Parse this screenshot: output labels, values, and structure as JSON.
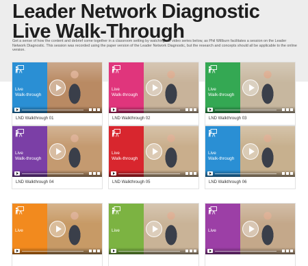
{
  "header": {
    "title_line1": "Leader Network Diagnostic",
    "title_line2": "Live Walk-Through",
    "intro": "Get a sense of how the content and debrief come together in a classroom setting by watching the video series below, as Phil Willburn facilitates a session on the Leader Network Diagnostic. This session was recorded using the paper version of the Leader Network Diagnostic, but the research and concepts should all be applicable to the online version."
  },
  "videos": [
    {
      "title": "LND Walkthrough 01",
      "live_line1": "Live",
      "live_line2": "Walk-through",
      "panel_color": "#2a8fd4",
      "photo_color": "#b98a63"
    },
    {
      "title": "LND Walkthrough 02",
      "live_line1": "Live",
      "live_line2": "Walk-through",
      "panel_color": "#e0357c",
      "photo_color": "#c8b39a"
    },
    {
      "title": "LND Walkthrough 03",
      "live_line1": "Live",
      "live_line2": "Walk-through",
      "panel_color": "#34a853",
      "photo_color": "#c7b79f"
    },
    {
      "title": "LND Walkthrough 04",
      "live_line1": "Live",
      "live_line2": "Walk-through",
      "panel_color": "#7b3fa6",
      "photo_color": "#c49a70"
    },
    {
      "title": "LND Walkthrough 05",
      "live_line1": "Live",
      "live_line2": "Walk-through",
      "panel_color": "#d8262e",
      "photo_color": "#c9ae8c"
    },
    {
      "title": "LND Walkthrough 06",
      "live_line1": "Live",
      "live_line2": "Walk-through",
      "panel_color": "#2a8fd4",
      "photo_color": "#c7b08e"
    },
    {
      "title": "",
      "live_line1": "Live",
      "live_line2": "",
      "panel_color": "#f28a1e",
      "photo_color": "#c79a66"
    },
    {
      "title": "",
      "live_line1": "Live",
      "live_line2": "",
      "panel_color": "#7cb342",
      "photo_color": "#c9b397"
    },
    {
      "title": "",
      "live_line1": "Live",
      "live_line2": "",
      "panel_color": "#9c3fa6",
      "photo_color": "#c4a88a"
    }
  ]
}
